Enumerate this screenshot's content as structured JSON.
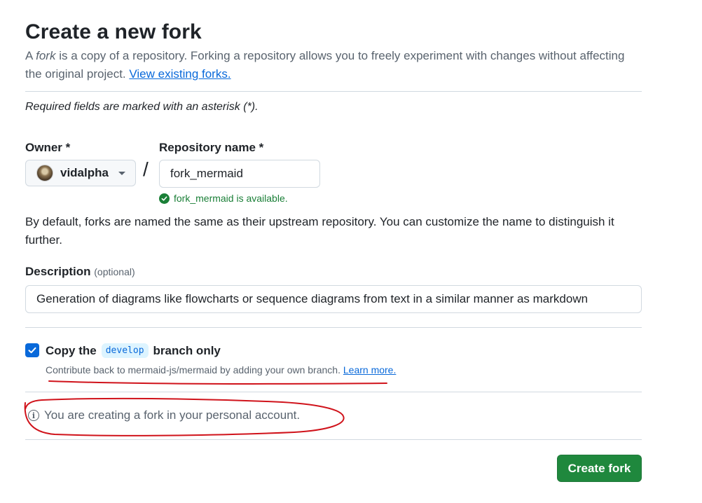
{
  "header": {
    "title": "Create a new fork",
    "intro_prefix": "A ",
    "intro_em": "fork",
    "intro_text": " is a copy of a repository. Forking a repository allows you to freely experiment with changes without affecting the original project. ",
    "view_forks_link": "View existing forks."
  },
  "form": {
    "required_note": "Required fields are marked with an asterisk (*).",
    "owner_label": "Owner *",
    "owner_value": "vidalpha",
    "owner_icon": "avatar",
    "separator": "/",
    "repo_label": "Repository name *",
    "repo_value": "fork_mermaid",
    "availability": "fork_mermaid is available.",
    "default_note": "By default, forks are named the same as their upstream repository. You can customize the name to distinguish it further.",
    "description_label": "Description",
    "description_optional": "(optional)",
    "description_value": "Generation of diagrams like flowcharts or sequence diagrams from text in a similar manner as markdown",
    "copy_prefix": "Copy the",
    "copy_branch": "develop",
    "copy_suffix": "branch only",
    "copy_checked": true,
    "contrib_text": "Contribute back to mermaid-js/mermaid by adding your own branch. ",
    "learn_more": "Learn more.",
    "info_text": "You are creating a fork in your personal account.",
    "create_button": "Create fork"
  },
  "colors": {
    "accent": "#0969da",
    "success": "#1a7f37",
    "button": "#1f883d",
    "annotation": "#d0131b"
  }
}
